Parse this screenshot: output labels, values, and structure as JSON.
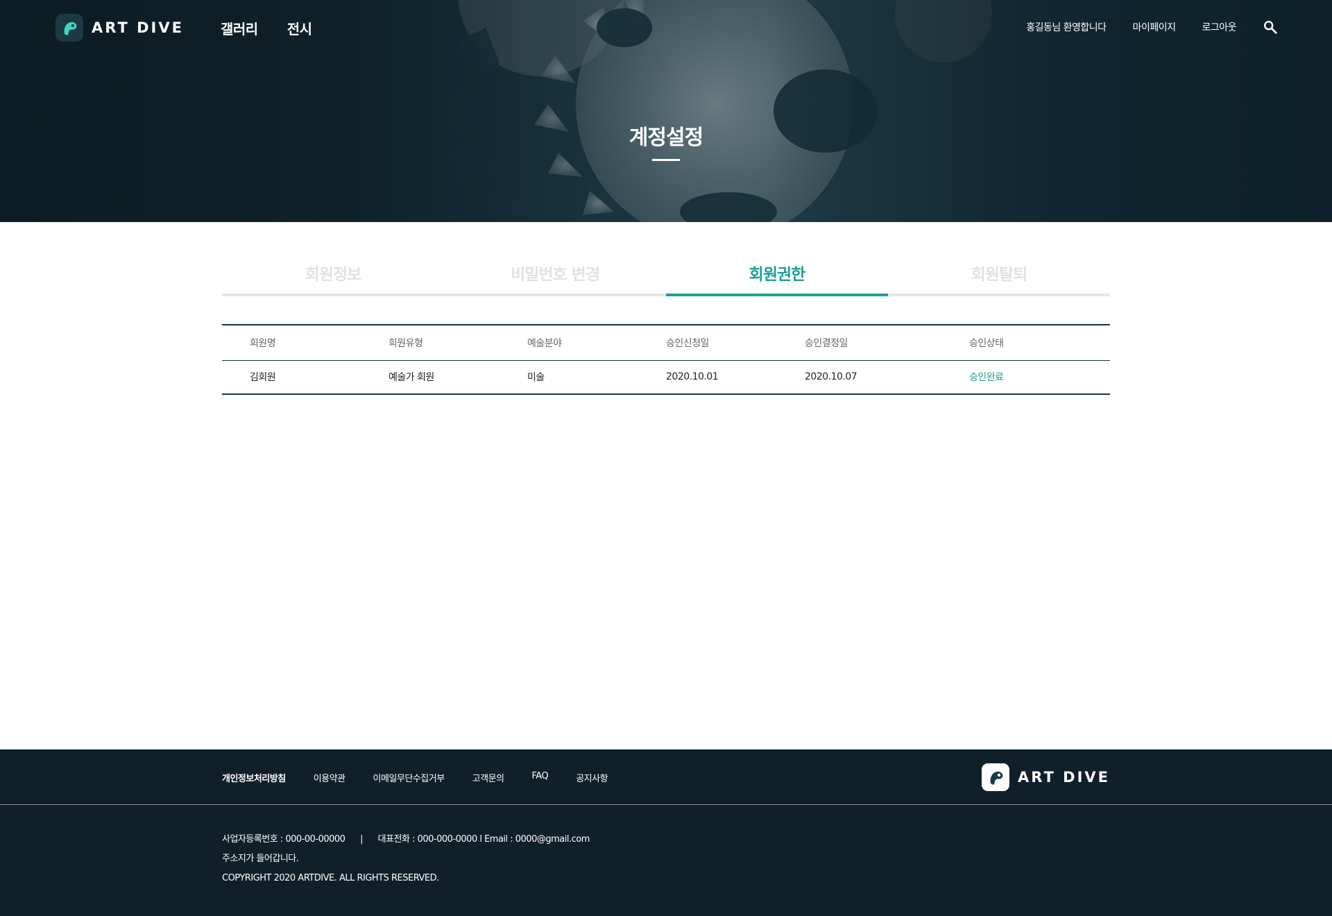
{
  "brand": {
    "name": "ART DIVE"
  },
  "nav": {
    "items": [
      "갤러리",
      "전시"
    ]
  },
  "utility": {
    "welcome": "홍길동님 환영합니다",
    "mypage": "마이페이지",
    "logout": "로그아웃",
    "search_icon": "search-icon"
  },
  "hero": {
    "title": "계정설정"
  },
  "tabs": [
    {
      "label": "회원정보",
      "active": false
    },
    {
      "label": "비밀번호 변경",
      "active": false
    },
    {
      "label": "회원권한",
      "active": true
    },
    {
      "label": "회원탈퇴",
      "active": false
    }
  ],
  "table": {
    "headers": [
      "회원명",
      "회원유형",
      "예술분야",
      "승인신청일",
      "승인결정일",
      "승인상태"
    ],
    "rows": [
      [
        "김회원",
        "예술가 회원",
        "미술",
        "2020.10.01",
        "2020.10.07",
        "승인완료"
      ]
    ]
  },
  "footer": {
    "links": [
      "개인정보처리방침",
      "이용약관",
      "이메일무단수집거부",
      "고객문의",
      "FAQ",
      "공지사항"
    ],
    "business_no": "사업자등록번호 : 000-00-00000",
    "separator": "|",
    "phone_email": "대표전화 : 000-000-0000  l Email : 0000@gmail.com",
    "address": "주소지가 들어갑니다.",
    "copyright": "COPYRIGHT 2020 ARTDIVE. ALL RIGHTS RESERVED."
  },
  "colors": {
    "accent": "#1aa294",
    "hero_dark": "#0f222b",
    "footer_bg": "#0f202a",
    "table_line": "#17313d",
    "tab_inactive": "#e2e2e2"
  }
}
